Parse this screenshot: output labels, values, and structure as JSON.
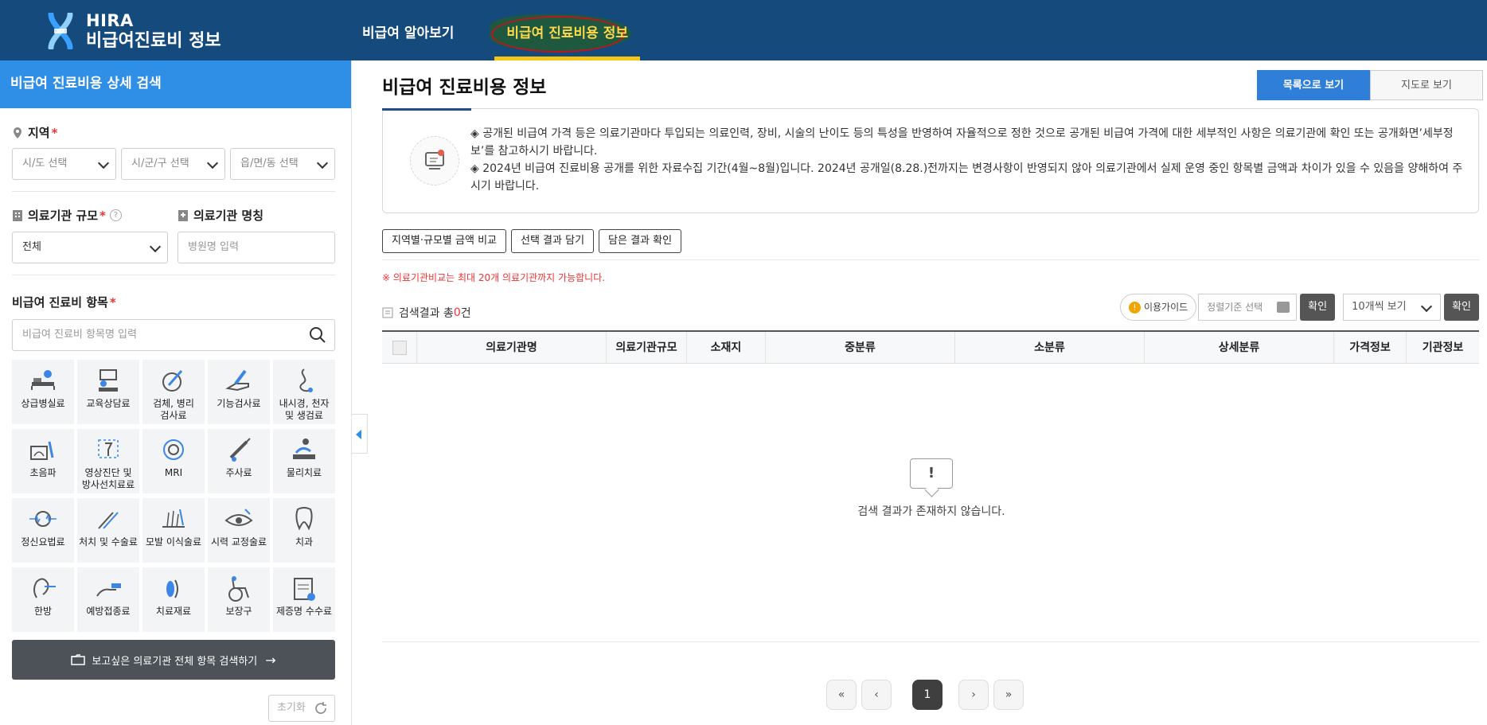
{
  "header": {
    "logo_line1": "HIRA",
    "logo_line2": "비급여진료비 정보",
    "nav": [
      {
        "label": "비급여 알아보기"
      },
      {
        "label": "비급여 진료비용 정보"
      }
    ]
  },
  "sidebar": {
    "title": "비급여 진료비용 상세 검색",
    "region_label": "지역",
    "region_selects": [
      "시/도 선택",
      "시/군/구 선택",
      "읍/면/동 선택"
    ],
    "scale_label": "의료기관 규모",
    "scale_value": "전체",
    "name_label": "의료기관 명칭",
    "name_placeholder": "병원명 입력",
    "items_label": "비급여 진료비 항목",
    "items_placeholder": "비급여 진료비 항목명 입력",
    "required_mark": "*",
    "help_mark": "?",
    "categories": [
      {
        "label": "상급병실료",
        "icon": "bed-icon"
      },
      {
        "label": "교육상담료",
        "icon": "counseling-icon"
      },
      {
        "label": "검체, 병리\n검사료",
        "icon": "test-icon"
      },
      {
        "label": "기능검사료",
        "icon": "function-test-icon"
      },
      {
        "label": "내시경, 천자\n및 생검료",
        "icon": "endoscope-icon"
      },
      {
        "label": "초음파",
        "icon": "ultrasound-icon"
      },
      {
        "label": "영상진단 및\n방사선치료료",
        "icon": "radiology-icon"
      },
      {
        "label": "MRI",
        "icon": "mri-icon"
      },
      {
        "label": "주사료",
        "icon": "injection-icon"
      },
      {
        "label": "물리치료",
        "icon": "physio-icon"
      },
      {
        "label": "정신요법료",
        "icon": "brain-icon"
      },
      {
        "label": "처치 및 수술료",
        "icon": "surgery-icon"
      },
      {
        "label": "모발 이식술료",
        "icon": "hair-icon"
      },
      {
        "label": "시력 교정술료",
        "icon": "eye-icon"
      },
      {
        "label": "치과",
        "icon": "tooth-icon"
      },
      {
        "label": "한방",
        "icon": "acupuncture-icon"
      },
      {
        "label": "예방접종료",
        "icon": "vaccine-icon"
      },
      {
        "label": "치료재료",
        "icon": "material-icon"
      },
      {
        "label": "보장구",
        "icon": "wheelchair-icon"
      },
      {
        "label": "제증명 수수료",
        "icon": "certificate-icon"
      }
    ],
    "search_all_label": "보고싶은 의료기관 전체 항목 검색하기",
    "search_all_arrow": "→",
    "reset_label": "초기화"
  },
  "main": {
    "title": "비급여 진료비용 정보",
    "view_tabs": [
      "목록으로 보기",
      "지도로 보기"
    ],
    "notice": [
      "◈ 공개된 비급여 가격 등은 의료기관마다 투입되는 의료인력, 장비, 시술의 난이도 등의 특성을 반영하여 자율적으로 정한 것으로 공개된 비급여 가격에 대한 세부적인 사항은 의료기관에 확인 또는 공개화면’세부정보’를 참고하시기 바랍니다.",
      "◈ 2024년 비급여 진료비용 공개를 위한 자료수집 기간(4월~8월)입니다. 2024년 공개일(8.28.)전까지는 변경사항이 반영되지 않아 의료기관에서 실제 운영 중인 항목별 금액과 차이가 있을 수 있음을 양해하여 주시기 바랍니다."
    ],
    "action_buttons": [
      "지역별·규모별 금액 비교",
      "선택 결과 담기",
      "담은 결과 확인"
    ],
    "warning": "※ 의료기관비교는 최대 20개 의료기관까지 가능합니다.",
    "result_prefix": "검색결과 총",
    "result_count": "0",
    "result_suffix": "건",
    "guide_label": "이용가이드",
    "guide_mark": "!",
    "sort_placeholder": "정렬기준 선택",
    "confirm_label": "확인",
    "page_size": "10개씩 보기",
    "columns": [
      "의료기관명",
      "의료기관규모",
      "소재지",
      "중분류",
      "소분류",
      "상세분류",
      "가격정보",
      "기관정보"
    ],
    "empty_mark": "!",
    "empty_text": "검색 결과가 존재하지 않습니다.",
    "pagination": {
      "first": "«",
      "prev": "‹",
      "current": "1",
      "next": "›",
      "last": "»"
    }
  },
  "colors": {
    "header_bg": "#154a7c",
    "accent_blue": "#2f8ee6",
    "active_nav": "#ffd84a",
    "required_red": "#e33333"
  }
}
